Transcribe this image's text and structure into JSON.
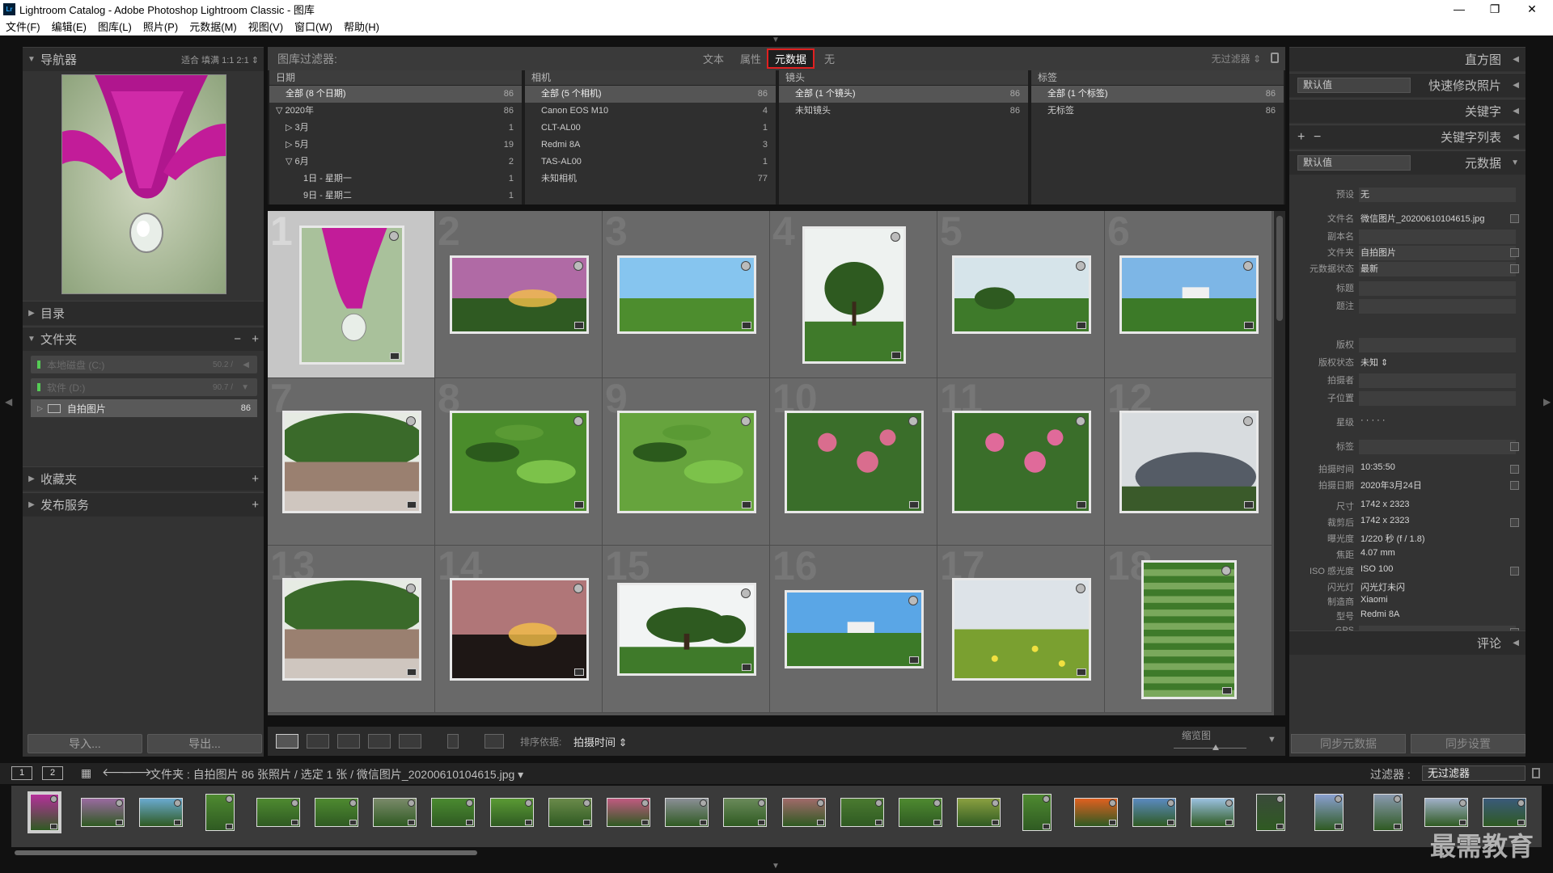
{
  "titlebar": {
    "icon": "Lr",
    "title": "Lightroom Catalog - Adobe Photoshop Lightroom Classic - 图库"
  },
  "menu": [
    "文件(F)",
    "编辑(E)",
    "图库(L)",
    "照片(P)",
    "元数据(M)",
    "视图(V)",
    "窗口(W)",
    "帮助(H)"
  ],
  "navigator": {
    "label": "导航器",
    "opts": "适合  填满  1:1  2:1 ⇕"
  },
  "left": {
    "catalog": "目录",
    "folders": "文件夹",
    "vol1": {
      "name": "本地磁盘 (C:)",
      "size": "50.2 /"
    },
    "vol2": {
      "name": "软件 (D:)",
      "size": "90.7 /"
    },
    "folder": {
      "name": "自拍图片",
      "count": "86"
    },
    "collections": "收藏夹",
    "publish": "发布服务",
    "import": "导入...",
    "export": "导出..."
  },
  "filter": {
    "label": "图库过滤器:",
    "tabs": [
      "文本",
      "属性",
      "元数据",
      "无"
    ],
    "nofilter": "无过滤器 ⇕"
  },
  "columns": {
    "date": {
      "title": "日期",
      "rows": [
        {
          "l": "全部 (8 个日期)",
          "c": "86"
        },
        {
          "l": "▽ 2020年",
          "c": "86"
        },
        {
          "l": "▷ 3月",
          "c": "1"
        },
        {
          "l": "▷ 5月",
          "c": "19"
        },
        {
          "l": "▽ 6月",
          "c": "2"
        },
        {
          "l": "1日 - 星期一",
          "c": "1"
        },
        {
          "l": "9日 - 星期二",
          "c": "1"
        }
      ]
    },
    "camera": {
      "title": "相机",
      "rows": [
        {
          "l": "全部 (5 个相机)",
          "c": "86"
        },
        {
          "l": "Canon EOS M10",
          "c": "4"
        },
        {
          "l": "CLT-AL00",
          "c": "1"
        },
        {
          "l": "Redmi 8A",
          "c": "3"
        },
        {
          "l": "TAS-AL00",
          "c": "1"
        },
        {
          "l": "未知相机",
          "c": "77"
        }
      ]
    },
    "lens": {
      "title": "镜头",
      "rows": [
        {
          "l": "全部 (1 个镜头)",
          "c": "86"
        },
        {
          "l": "未知镜头",
          "c": "86"
        }
      ]
    },
    "label": {
      "title": "标签",
      "rows": [
        {
          "l": "全部 (1 个标签)",
          "c": "86"
        },
        {
          "l": "无标签",
          "c": "86"
        }
      ]
    }
  },
  "grid": {
    "cells": [
      "1",
      "2",
      "3",
      "4",
      "5",
      "6",
      "7",
      "8",
      "9",
      "10",
      "11",
      "12",
      "13",
      "14",
      "15",
      "16",
      "17",
      "18"
    ]
  },
  "toolbar": {
    "sort_label": "排序依据:",
    "sort_value": "拍摄时间 ⇕",
    "zoom_label": "缩览图"
  },
  "right": {
    "histogram": "直方图",
    "preset_default": "默认值",
    "quickdev": "快速修改照片",
    "keywords": "关键字",
    "keywordlist": "关键字列表",
    "meta_default": "默认值",
    "metadata": "元数据",
    "comments": "评论",
    "sync_meta": "同步元数据",
    "sync_settings": "同步设置",
    "fields": [
      {
        "k": "预设",
        "v": "无"
      },
      {
        "k": "文件名",
        "v": "微信图片_20200610104615.jpg"
      },
      {
        "k": "副本名",
        "v": ""
      },
      {
        "k": "文件夹",
        "v": "自拍图片"
      },
      {
        "k": "元数据状态",
        "v": "最新"
      },
      {
        "k": "标题",
        "v": ""
      },
      {
        "k": "题注",
        "v": ""
      },
      {
        "k": "版权",
        "v": ""
      },
      {
        "k": "版权状态",
        "v": "未知 ⇕"
      },
      {
        "k": "拍摄者",
        "v": ""
      },
      {
        "k": "子位置",
        "v": ""
      },
      {
        "k": "星级",
        "v": "·  ·  ·  ·  ·"
      },
      {
        "k": "标签",
        "v": ""
      },
      {
        "k": "拍摄时间",
        "v": "10:35:50"
      },
      {
        "k": "拍摄日期",
        "v": "2020年3月24日"
      },
      {
        "k": "尺寸",
        "v": "1742 x 2323"
      },
      {
        "k": "裁剪后",
        "v": "1742 x 2323"
      },
      {
        "k": "曝光度",
        "v": "1/220 秒 (f / 1.8)"
      },
      {
        "k": "焦距",
        "v": "4.07 mm"
      },
      {
        "k": "ISO 感光度",
        "v": "ISO 100"
      },
      {
        "k": "闪光灯",
        "v": "闪光灯未闪"
      },
      {
        "k": "制造商",
        "v": "Xiaomi"
      },
      {
        "k": "型号",
        "v": "Redmi 8A"
      },
      {
        "k": "GPS",
        "v": ""
      }
    ]
  },
  "filmbar": {
    "page1": "1",
    "page2": "2",
    "path": "文件夹 : 自拍图片    86 张照片 / 选定 1 张 / 微信图片_20200610104615.jpg ▾",
    "filter_label": "过滤器 :",
    "filter_value": "无过滤器"
  },
  "watermark": "最需教育"
}
